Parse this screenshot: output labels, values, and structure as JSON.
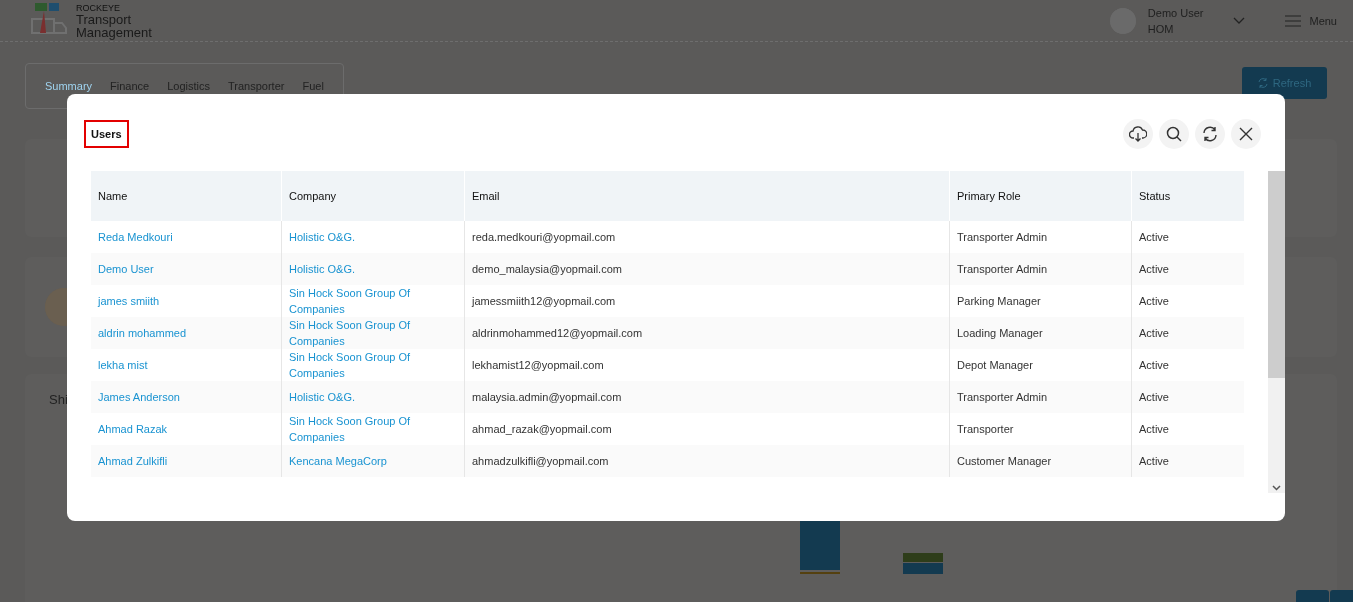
{
  "header": {
    "brand_small": "ROCKEYE",
    "brand": "Transport Management",
    "user_name": "Demo User",
    "user_role": "HOM",
    "menu_label": "Menu"
  },
  "tabs": [
    {
      "label": "Summary",
      "selected": true
    },
    {
      "label": "Finance",
      "selected": false
    },
    {
      "label": "Logistics",
      "selected": false
    },
    {
      "label": "Transporter",
      "selected": false
    },
    {
      "label": "Fuel",
      "selected": false
    }
  ],
  "refresh_button": "Refresh",
  "section_title": "Shi",
  "modal": {
    "title": "Users",
    "columns": [
      "Name",
      "Company",
      "Email",
      "Primary Role",
      "Status"
    ],
    "rows": [
      {
        "name": "Reda Medkouri",
        "company": "Holistic O&G.",
        "email": "reda.medkouri@yopmail.com",
        "role": "Transporter Admin",
        "status": "Active"
      },
      {
        "name": "Demo User",
        "company": "Holistic O&G.",
        "email": "demo_malaysia@yopmail.com",
        "role": "Transporter Admin",
        "status": "Active"
      },
      {
        "name": "james smiith",
        "company": "Sin Hock Soon Group Of Companies",
        "email": "jamessmiith12@yopmail.com",
        "role": "Parking Manager",
        "status": "Active"
      },
      {
        "name": "aldrin mohammed",
        "company": "Sin Hock Soon Group Of Companies",
        "email": "aldrinmohammed12@yopmail.com",
        "role": "Loading Manager",
        "status": "Active"
      },
      {
        "name": "lekha mist",
        "company": "Sin Hock Soon Group Of Companies",
        "email": "lekhamist12@yopmail.com",
        "role": "Depot Manager",
        "status": "Active"
      },
      {
        "name": "James Anderson",
        "company": "Holistic O&G.",
        "email": "malaysia.admin@yopmail.com",
        "role": "Transporter Admin",
        "status": "Active"
      },
      {
        "name": "Ahmad Razak",
        "company": "Sin Hock Soon Group Of Companies",
        "email": "ahmad_razak@yopmail.com",
        "role": "Transporter",
        "status": "Active"
      },
      {
        "name": "Ahmad Zulkifli",
        "company": "Kencana MegaCorp",
        "email": "ahmadzulkifli@yopmail.com",
        "role": "Customer Manager",
        "status": "Active"
      }
    ]
  }
}
